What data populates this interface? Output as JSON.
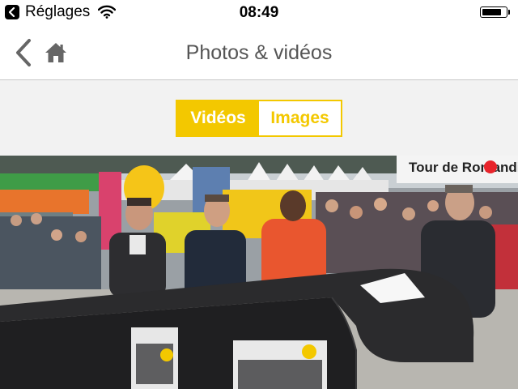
{
  "status_bar": {
    "back_app_label": "Réglages",
    "time": "08:49",
    "battery_level": 0.85
  },
  "nav": {
    "title": "Photos & vidéos"
  },
  "segments": [
    {
      "label": "Vidéos",
      "active": true
    },
    {
      "label": "Images",
      "active": false
    }
  ],
  "video": {
    "banner_text": "Tour de Romandie"
  },
  "colors": {
    "accent": "#f3c800",
    "nav_text": "#555555"
  },
  "icons": [
    "chevron-left-icon",
    "home-icon",
    "wifi-icon",
    "battery-icon"
  ]
}
